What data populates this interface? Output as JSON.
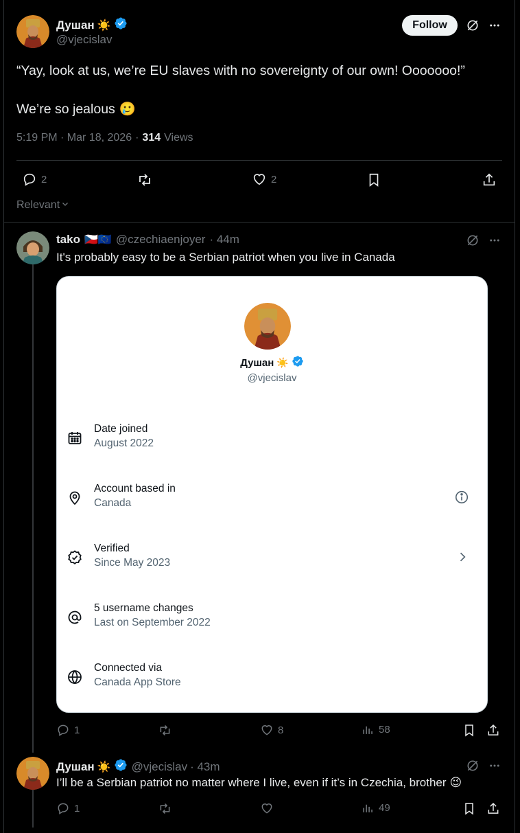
{
  "tweet": {
    "author_name": "Душан",
    "author_emoji": "☀️",
    "author_handle": "@vjecislav",
    "follow_label": "Follow",
    "text_line1": "“Yay, look at us, we’re EU slaves with no sovereignty of our own! Ooooooo!”",
    "text_line2": "We’re so jealous",
    "text_emoji": "🥲",
    "timestamp": "5:19 PM · Mar 18, 2026",
    "sep": "·",
    "views_count": "314",
    "views_label": "Views",
    "replies": "2",
    "likes": "2"
  },
  "sort": {
    "label": "Relevant"
  },
  "reply1": {
    "name": "tako",
    "flags": "🇨🇿🇪🇺",
    "handle": "@czechiaenjoyer",
    "time": "· 44m",
    "text": "It's probably easy to be a Serbian patriot when you live in Canada",
    "replies": "1",
    "likes": "8",
    "views": "58"
  },
  "card": {
    "name": "Душан",
    "emoji": "☀️",
    "handle": "@vjecislav",
    "rows": [
      {
        "title": "Date joined",
        "sub": "August 2022",
        "icon": "calendar-icon"
      },
      {
        "title": "Account based in",
        "sub": "Canada",
        "icon": "location-pin-icon"
      },
      {
        "title": "Verified",
        "sub": "Since May 2023",
        "icon": "verified-badge-icon"
      },
      {
        "title": "5 username changes",
        "sub": "Last on September 2022",
        "icon": "at-sign-icon"
      },
      {
        "title": "Connected via",
        "sub": "Canada App Store",
        "icon": "globe-icon"
      }
    ]
  },
  "reply2": {
    "name": "Душан",
    "emoji": "☀️",
    "handle": "@vjecislav",
    "time": "· 43m",
    "text": "I’ll be a Serbian patriot no matter where I live, even if it’s in Czechia, brother",
    "text_emoji": "😉",
    "replies": "1",
    "views": "49"
  },
  "colors": {
    "verified": "#1d9bf0",
    "background": "#000000",
    "muted": "#71767b"
  }
}
